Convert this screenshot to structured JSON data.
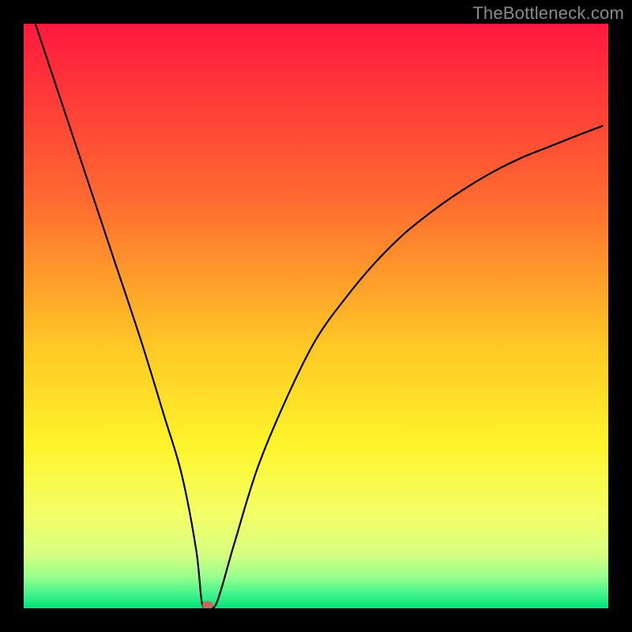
{
  "watermark": {
    "text": "TheBottleneck.com"
  },
  "colors": {
    "top": "#ff183f",
    "mid_upper": "#ff8b2d",
    "mid": "#ffe324",
    "lower": "#f7ff6c",
    "near_bottom": "#b4ff8e",
    "bottom": "#00e27a",
    "curve": "#000000",
    "marker": "#c46b5e",
    "frame": "#000000"
  },
  "chart_data": {
    "type": "line",
    "title": "",
    "xlabel": "",
    "ylabel": "",
    "xlim": [
      0,
      100
    ],
    "ylim": [
      0,
      100
    ],
    "series": [
      {
        "name": "bottleneck-curve",
        "x": [
          2,
          5,
          10,
          15,
          20,
          24,
          27,
          29.5,
          30.5,
          31.5,
          33,
          36,
          40,
          45,
          50,
          55,
          60,
          65,
          70,
          75,
          80,
          85,
          90,
          95,
          99
        ],
        "y": [
          100,
          91,
          76,
          61,
          46,
          33,
          23,
          10,
          0.9,
          0.6,
          0.9,
          11,
          24,
          36,
          46,
          53,
          59,
          64,
          68,
          71.5,
          74.5,
          77,
          79,
          81,
          82.5
        ]
      }
    ],
    "marker": {
      "x": 31.5,
      "y": 0.55
    },
    "gradient_stops": [
      {
        "offset": 0.0,
        "color": "#ff183f"
      },
      {
        "offset": 0.3,
        "color": "#ff6a30"
      },
      {
        "offset": 0.55,
        "color": "#ffc726"
      },
      {
        "offset": 0.72,
        "color": "#fff42a"
      },
      {
        "offset": 0.84,
        "color": "#f3ff68"
      },
      {
        "offset": 0.905,
        "color": "#d8ff80"
      },
      {
        "offset": 0.945,
        "color": "#9bff8c"
      },
      {
        "offset": 0.972,
        "color": "#4cf58e"
      },
      {
        "offset": 1.0,
        "color": "#00e27a"
      }
    ]
  }
}
